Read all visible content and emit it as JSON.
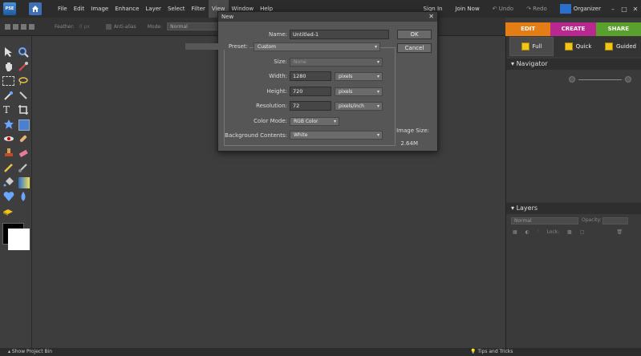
{
  "app": {
    "logo_text": "PSE"
  },
  "menu": {
    "items": [
      "File",
      "Edit",
      "Image",
      "Enhance",
      "Layer",
      "Select",
      "Filter",
      "View",
      "Window",
      "Help"
    ],
    "active": "View",
    "sign_in": "Sign In",
    "join_now": "Join Now",
    "undo": "Undo",
    "redo": "Redo",
    "organizer": "Organizer"
  },
  "options_bar": {
    "feather_label": "Feather:",
    "feather_value": "0 px",
    "anti_alias_label": "Anti-alias",
    "mode_label": "Mode:",
    "mode_value": "Normal"
  },
  "mode_tabs": [
    "EDIT",
    "CREATE",
    "SHARE"
  ],
  "accent_colors": {
    "edit": "#e57d16",
    "create": "#b9288f",
    "share": "#5aa02c"
  },
  "sub_tabs": [
    "Full",
    "Quick",
    "Guided"
  ],
  "panels": {
    "navigator": "Navigator",
    "layers": "Layers"
  },
  "layers": {
    "blend_mode": "Normal",
    "opacity_label": "Opacity:",
    "lock_label": "Lock:"
  },
  "status": {
    "project_bin": "Show Project Bin",
    "tips": "Tips and Tricks"
  },
  "dialog": {
    "title": "New",
    "name_label": "Name:",
    "name_value": "Untitled-1",
    "preset_label": "Preset:",
    "preset_value": "Custom",
    "size_label": "Size:",
    "size_value": "None",
    "width_label": "Width:",
    "width_value": "1280",
    "width_unit": "pixels",
    "height_label": "Height:",
    "height_value": "720",
    "height_unit": "pixels",
    "resolution_label": "Resolution:",
    "resolution_value": "72",
    "resolution_unit": "pixels/inch",
    "color_mode_label": "Color Mode:",
    "color_mode_value": "RGB Color",
    "bg_contents_label": "Background Contents:",
    "bg_contents_value": "White",
    "ok": "OK",
    "cancel": "Cancel",
    "image_size_label": "Image Size:",
    "image_size_value": "2.64M"
  }
}
